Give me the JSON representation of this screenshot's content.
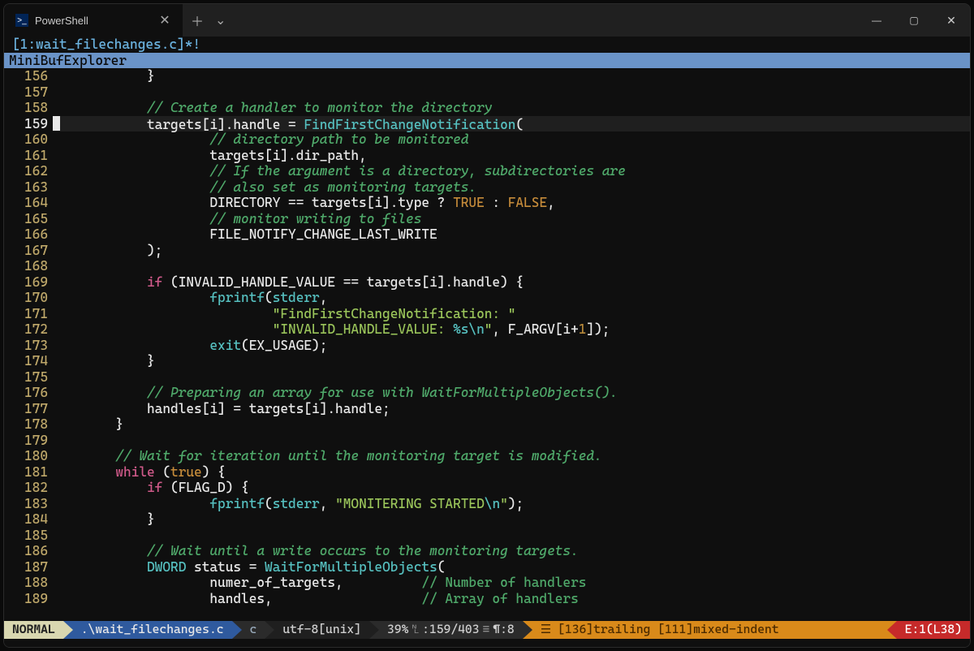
{
  "titlebar": {
    "tab_label": "PowerShell"
  },
  "header": {
    "buffer_tag": "[1:wait_filechanges.c]*!"
  },
  "minibuf": "MiniBufExplorer",
  "gutter": {
    "start": 156,
    "end": 189,
    "current": 159
  },
  "lines": {
    "l156": "            }",
    "l157": "",
    "l158_c": "            // Create a handler to monitor the directory",
    "l159_a": "            targets[i].handle = ",
    "l159_fn": "FindFirstChangeNotification",
    "l159_b": "(",
    "l160_c": "                    // directory path to be monitored",
    "l161": "                    targets[i].dir_path,",
    "l162_c": "                    // If the argument is a directory, subdirectories are",
    "l163_c": "                    // also set as monitoring targets.",
    "l164_a": "                    DIRECTORY == targets[i].type ? ",
    "l164_t": "TRUE",
    "l164_m": " : ",
    "l164_f": "FALSE",
    "l164_e": ",",
    "l165_c": "                    // monitor writing to files",
    "l166": "                    FILE_NOTIFY_CHANGE_LAST_WRITE",
    "l167": "            );",
    "l168": "",
    "l169_a": "            ",
    "l169_kw": "if",
    "l169_b": " (INVALID_HANDLE_VALUE == targets[i].handle) {",
    "l170_a": "                    ",
    "l170_fn": "fprintf",
    "l170_b": "(",
    "l170_id": "stderr",
    "l170_c": ",",
    "l171_a": "                            ",
    "l171_s": "\"FindFirstChangeNotification: \"",
    "l172_a": "                            ",
    "l172_s": "\"INVALID_HANDLE_VALUE: ",
    "l172_es": "%s\\n",
    "l172_se": "\"",
    "l172_b": ", F_ARGV[i+",
    "l172_n": "1",
    "l172_e": "]);",
    "l173_a": "                    ",
    "l173_fn": "exit",
    "l173_b": "(EX_USAGE);",
    "l174": "            }",
    "l175": "",
    "l176_c": "            // Preparing an array for use with WaitForMultipleObjects().",
    "l177": "            handles[i] = targets[i].handle;",
    "l178": "        }",
    "l179": "",
    "l180_c": "        // Wait for iteration until the monitoring target is modified.",
    "l181_a": "        ",
    "l181_kw": "while",
    "l181_b": " (",
    "l181_tf": "true",
    "l181_e": ") {",
    "l182_a": "            ",
    "l182_kw": "if",
    "l182_b": " (FLAG_D) {",
    "l183_a": "                    ",
    "l183_fn": "fprintf",
    "l183_b": "(",
    "l183_id": "stderr",
    "l183_c": ", ",
    "l183_s": "\"MONITERING STARTED",
    "l183_es": "\\n",
    "l183_se": "\"",
    "l183_e": ");",
    "l184": "            }",
    "l185": "",
    "l186_c": "            // Wait until a write occurs to the monitoring targets.",
    "l187_a": "            ",
    "l187_ty": "DWORD",
    "l187_b": " status = ",
    "l187_fn": "WaitForMultipleObjects",
    "l187_e": "(",
    "l188_a": "                    numer_of_targets,          ",
    "l188_c": "// Number of handlers",
    "l189_a": "                    handles,                   ",
    "l189_c": "// Array of handlers"
  },
  "status": {
    "mode": "NORMAL",
    "file": ".\\wait_filechanges.c",
    "ft": "c",
    "enc": "utf-8[unix]",
    "pct": "39%",
    "line": "159",
    "total": "403",
    "col": "8",
    "warn": "[136]trailing [111]mixed-indent",
    "warn_icon": "☰",
    "err": "E:1(L38)"
  }
}
